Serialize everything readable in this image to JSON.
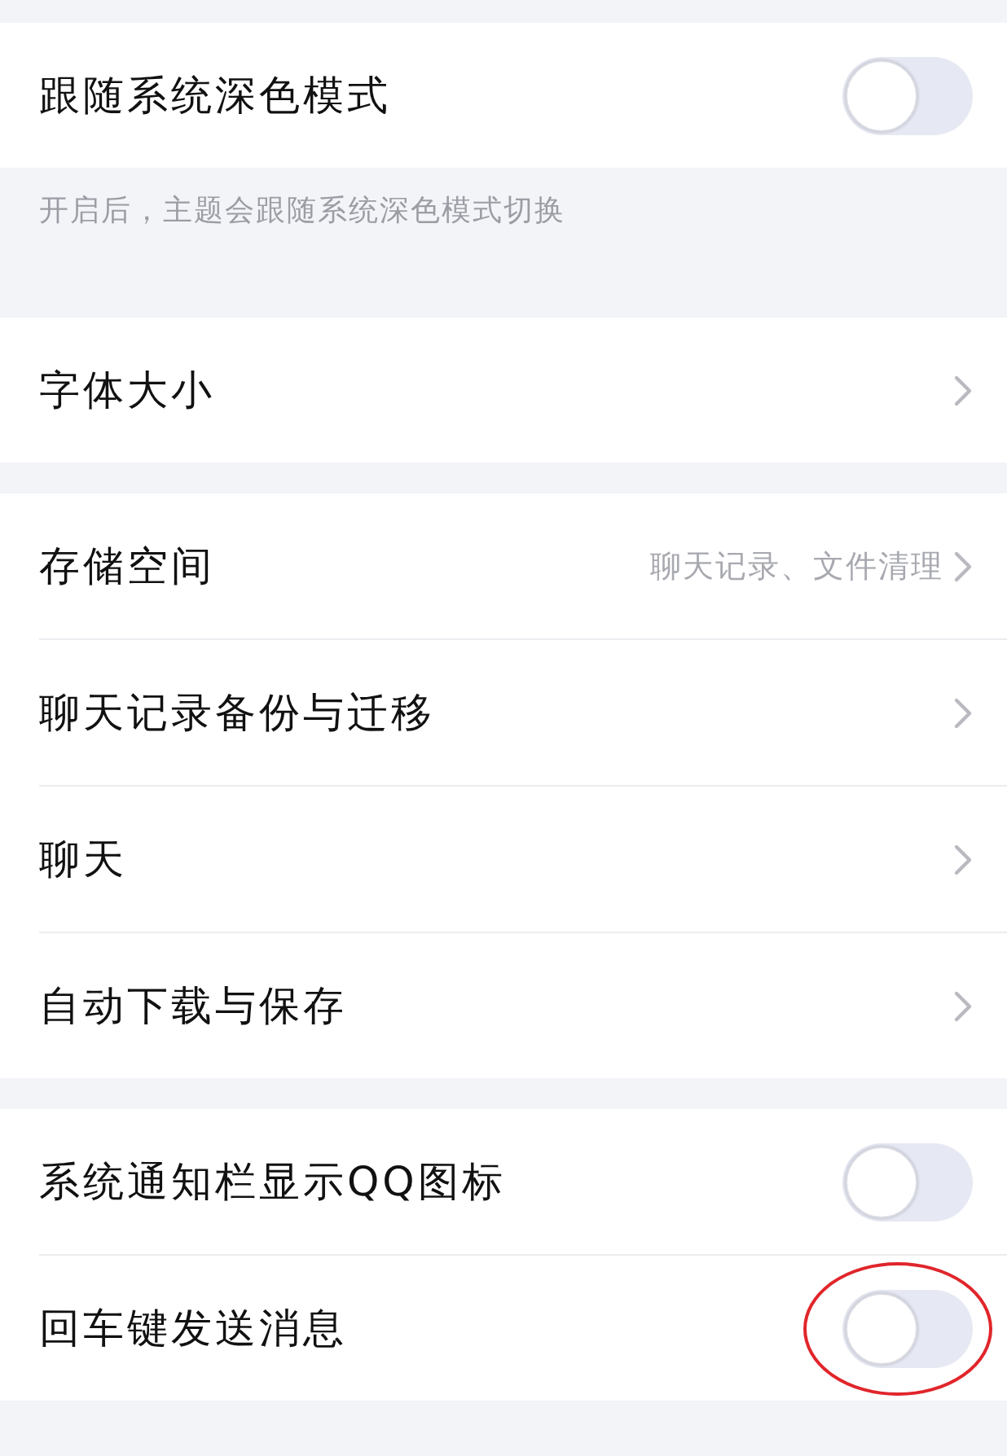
{
  "sections": [
    {
      "rows": [
        {
          "kind": "toggle",
          "label": "跟随系统深色模式",
          "on": false,
          "annotated": false
        }
      ],
      "note": "开启后，主题会跟随系统深色模式切换"
    },
    {
      "rows": [
        {
          "kind": "link",
          "label": "字体大小"
        }
      ]
    },
    {
      "rows": [
        {
          "kind": "link",
          "label": "存储空间",
          "detail": "聊天记录、文件清理"
        },
        {
          "kind": "link",
          "label": "聊天记录备份与迁移"
        },
        {
          "kind": "link",
          "label": "聊天"
        },
        {
          "kind": "link",
          "label": "自动下载与保存"
        }
      ]
    },
    {
      "rows": [
        {
          "kind": "toggle",
          "label": "系统通知栏显示QQ图标",
          "on": false,
          "annotated": false
        },
        {
          "kind": "toggle",
          "label": "回车键发送消息",
          "on": false,
          "annotated": true
        }
      ]
    }
  ]
}
